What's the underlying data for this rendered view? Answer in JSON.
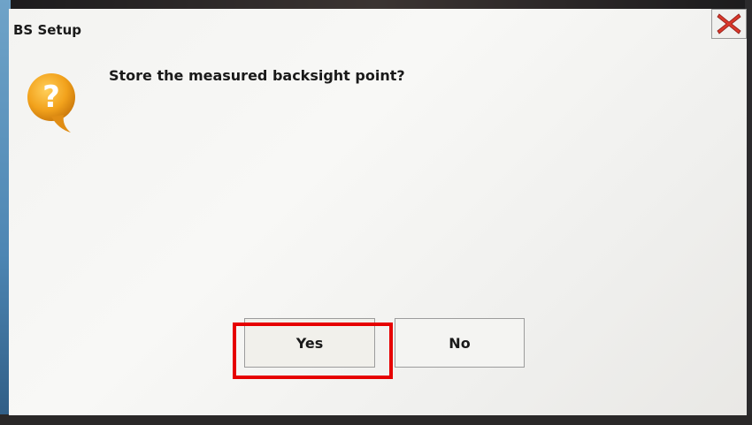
{
  "dialog": {
    "title": "BS Setup",
    "message": "Store the measured backsight point?",
    "icons": {
      "question": "question-icon",
      "close": "close-icon"
    },
    "buttons": {
      "yes_label": "Yes",
      "no_label": "No"
    }
  },
  "annotation": {
    "highlight_color": "#e60000",
    "highlighted": "yes-button"
  },
  "colors": {
    "icon_orange": "#f0a020",
    "close_red": "#d8382b"
  }
}
